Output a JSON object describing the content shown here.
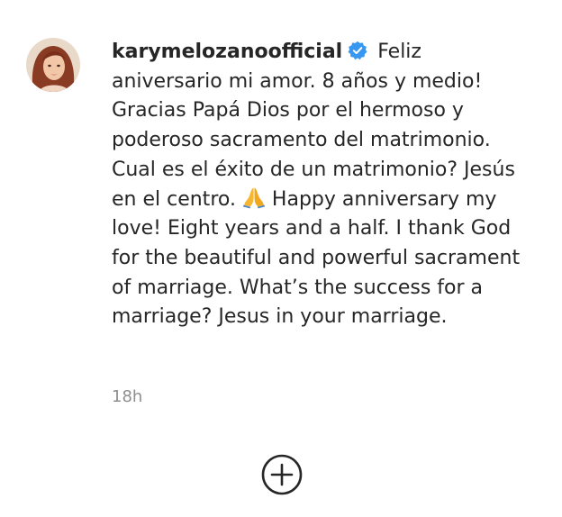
{
  "post": {
    "author": {
      "username": "karymelozanoofficial",
      "verified": true,
      "avatar_icon": "profile-photo"
    },
    "caption_segments": {
      "part1": " Feliz aniversario mi amor. 8 años y medio! Gracias Papá Dios por el hermoso y poderoso sacramento del matrimonio. Cual es el éxito de un matrimonio? Jesús en el centro. ",
      "emoji_name": "folded-hands-icon",
      "part2": " Happy anniversary my love! Eight years and a half. I thank God for the beautiful and powerful sacrament of marriage. What’s the success for a marriage? Jesus in your marriage."
    },
    "timestamp": "18h",
    "load_more_icon": "plus-circle-icon"
  },
  "colors": {
    "text": "#262626",
    "muted": "#8e8e8e",
    "verified_badge": "#3897f0",
    "background": "#ffffff"
  }
}
